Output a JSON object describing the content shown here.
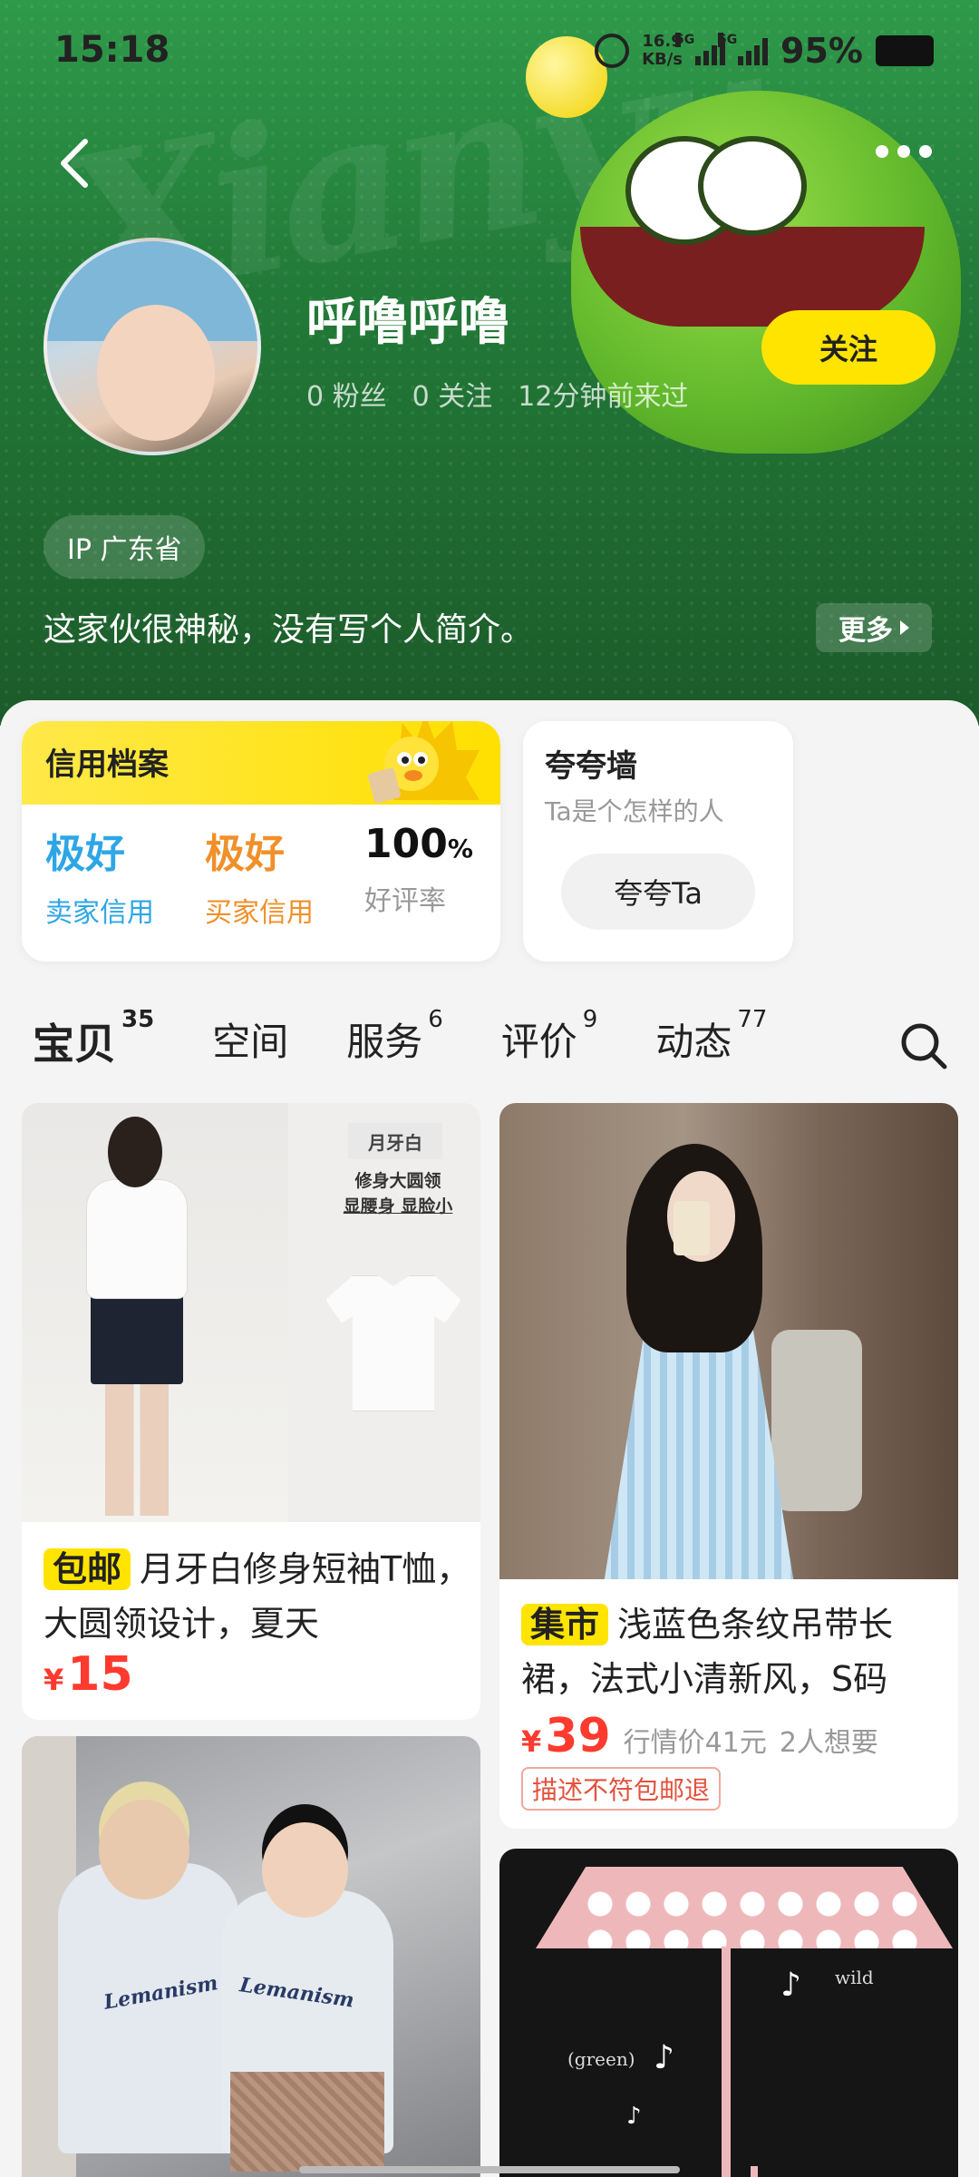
{
  "status_bar": {
    "time": "15:18",
    "net_speed": "16.9",
    "net_unit": "KB/s",
    "sig1": "5G",
    "sig2": "5G",
    "battery": "95%"
  },
  "header": {
    "wordmark": "Xianyu"
  },
  "profile": {
    "name": "呼噜呼噜",
    "fans": "0 粉丝",
    "following": "0 关注",
    "last_seen": "12分钟前来过",
    "follow_label": "关注",
    "ip": "IP 广东省",
    "bio": "这家伙很神秘，没有写个人简介。",
    "more_label": "更多"
  },
  "credit": {
    "title": "信用档案",
    "seller_value": "极好",
    "seller_label": "卖家信用",
    "buyer_value": "极好",
    "buyer_label": "买家信用",
    "rating_value": "100",
    "rating_unit": "%",
    "rating_label": "好评率"
  },
  "praise": {
    "title": "夸夸墙",
    "subtitle": "Ta是个怎样的人",
    "button": "夸夸Ta"
  },
  "tabs": [
    {
      "label": "宝贝",
      "count": "35"
    },
    {
      "label": "空间",
      "count": ""
    },
    {
      "label": "服务",
      "count": "6"
    },
    {
      "label": "评价",
      "count": "9"
    },
    {
      "label": "动态",
      "count": "77"
    }
  ],
  "products": [
    {
      "tag": "包邮",
      "title": "月牙白修身短袖T恤，大圆领设计，夏天",
      "yen": "¥",
      "price": "15",
      "img_tag": "月牙白",
      "img_note_1": "修身大圆领",
      "img_note_2": "显腰身 显脸小"
    },
    {
      "tag": "集市",
      "title": "浅蓝色条纹吊带长裙，法式小清新风，S码",
      "yen": "¥",
      "price": "39",
      "market_price": "行情价41元",
      "wants": "2人想要",
      "badge": "描述不符包邮退"
    },
    {
      "print_1": "Lemanism",
      "print_2": "Lemanism"
    },
    {
      "scribble_1": "wild",
      "scribble_2": "(green)"
    }
  ],
  "colors": {
    "brand_yellow": "#ffe400",
    "header_green": "#227a38",
    "price_red": "#ff3a2e",
    "seller_blue": "#2ea6e6",
    "buyer_orange": "#f0902a"
  }
}
